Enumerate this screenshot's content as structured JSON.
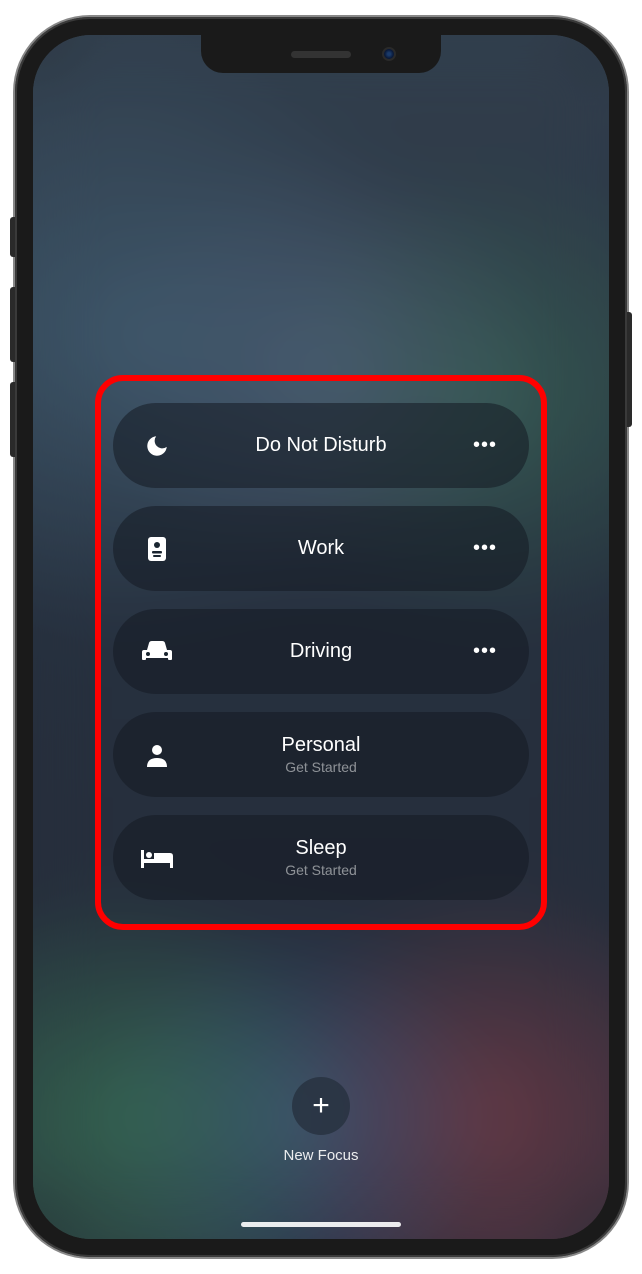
{
  "focus": {
    "items": [
      {
        "label": "Do Not Disturb",
        "subtitle": "",
        "icon": "moon",
        "has_more": true
      },
      {
        "label": "Work",
        "subtitle": "",
        "icon": "badge",
        "has_more": true
      },
      {
        "label": "Driving",
        "subtitle": "",
        "icon": "car",
        "has_more": true
      },
      {
        "label": "Personal",
        "subtitle": "Get Started",
        "icon": "person",
        "has_more": false
      },
      {
        "label": "Sleep",
        "subtitle": "Get Started",
        "icon": "bed",
        "has_more": false
      }
    ],
    "new_label": "New Focus"
  }
}
